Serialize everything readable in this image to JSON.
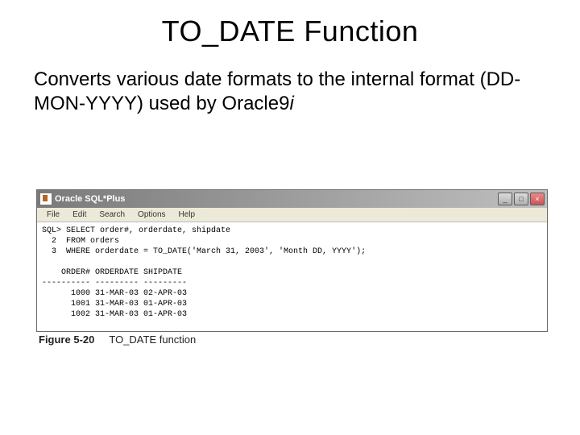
{
  "title": "TO_DATE Function",
  "body_text_a": "Converts various date formats to the internal format (DD-MON-YYYY) used by Oracle",
  "body_text_b": "9",
  "body_text_c": "i",
  "window": {
    "title": "Oracle SQL*Plus",
    "minimize": "_",
    "maximize": "□",
    "close": "×"
  },
  "menu": {
    "file": "File",
    "edit": "Edit",
    "search": "Search",
    "options": "Options",
    "help": "Help"
  },
  "terminal_text": "SQL> SELECT order#, orderdate, shipdate\n  2  FROM orders\n  3  WHERE orderdate = TO_DATE('March 31, 2003', 'Month DD, YYYY');\n\n    ORDER# ORDERDATE SHIPDATE\n---------- --------- ---------\n      1000 31-MAR-03 02-APR-03\n      1001 31-MAR-03 01-APR-03\n      1002 31-MAR-03 01-APR-03",
  "caption": {
    "num": "Figure 5-20",
    "text": "TO_DATE function"
  }
}
